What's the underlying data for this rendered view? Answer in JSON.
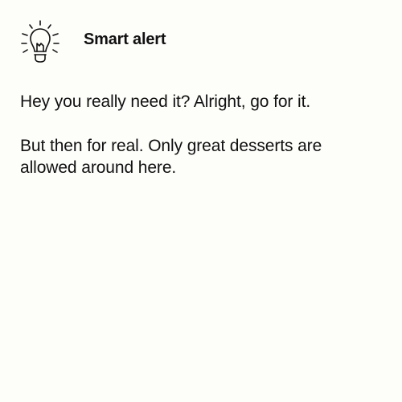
{
  "alert": {
    "icon": "lightbulb-icon",
    "title": "Smart alert",
    "messages": [
      "Hey you really need it? Alright, go for it.",
      "But then for real. Only great desserts are allowed around here."
    ]
  },
  "colors": {
    "background": "#fdfdfa",
    "text": "#111111"
  }
}
